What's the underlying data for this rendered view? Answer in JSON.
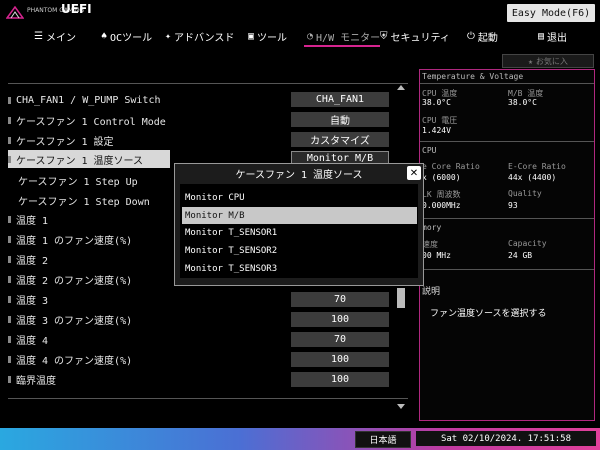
{
  "header": {
    "brand_small": "PHANTOM GAMING",
    "brand_uefi": "UEFI",
    "easy_mode_label": "Easy Mode(F6)",
    "tabs": [
      {
        "label": "メイン",
        "icon": "list-icon"
      },
      {
        "label": "OCツール",
        "icon": "flame-icon"
      },
      {
        "label": "アドバンスド",
        "icon": "star-icon"
      },
      {
        "label": "ツール",
        "icon": "toolbox-icon"
      },
      {
        "label": "H/W モニター",
        "icon": "gauge-icon"
      },
      {
        "label": "セキュリティ",
        "icon": "shield-icon"
      },
      {
        "label": "起動",
        "icon": "power-icon"
      },
      {
        "label": "退出",
        "icon": "exit-icon"
      }
    ],
    "favorites_label": "お気に入"
  },
  "settings": [
    {
      "label": "CHA_FAN1 / W_PUMP Switch",
      "value": "CHA_FAN1"
    },
    {
      "label": "ケースファン 1 Control Mode",
      "value": "自動"
    },
    {
      "label": "ケースファン 1 設定",
      "value": "カスタマイズ"
    },
    {
      "label": "ケースファン 1 温度ソース",
      "value": "Monitor M/B"
    },
    {
      "label": "ケースファン 1 Step Up",
      "value": ""
    },
    {
      "label": "ケースファン 1 Step Down",
      "value": ""
    },
    {
      "label": "温度 1",
      "value": ""
    },
    {
      "label": "温度 1 のファン速度(%)",
      "value": ""
    },
    {
      "label": "温度 2",
      "value": ""
    },
    {
      "label": "温度 2 のファン速度(%)",
      "value": ""
    },
    {
      "label": "温度 3",
      "value": "70"
    },
    {
      "label": "温度 3 のファン速度(%)",
      "value": "100"
    },
    {
      "label": "温度 4",
      "value": "70"
    },
    {
      "label": "温度 4 のファン速度(%)",
      "value": "100"
    },
    {
      "label": "臨界温度",
      "value": "100"
    }
  ],
  "modal": {
    "title": "ケースファン 1 温度ソース",
    "options": [
      "Monitor CPU",
      "Monitor M/B",
      "Monitor T_SENSOR1",
      "Monitor T_SENSOR2",
      "Monitor T_SENSOR3"
    ],
    "selected_index": 1
  },
  "right_panel": {
    "section1": "Temperature & Voltage",
    "cpu_temp_label": "CPU 温度",
    "cpu_temp_value": "38.0°C",
    "mb_temp_label": "M/B 温度",
    "mb_temp_value": "38.0°C",
    "cpu_volt_label": "CPU 電圧",
    "cpu_volt_value": "1.424V",
    "section2": "CPU",
    "pcore_label": "e Core Ratio",
    "pcore_value": "x (6000)",
    "ecore_label": "E-Core Ratio",
    "ecore_value": "44x (4400)",
    "bclk_label": "LK 周波数",
    "bclk_value": "0.000MHz",
    "quality_label": "Quality",
    "quality_value": "93",
    "section3": "mory",
    "speed_label": "速度",
    "speed_value": "00 MHz",
    "capacity_label": "Capacity",
    "capacity_value": "24 GB",
    "desc_title": "説明",
    "description": "ファン温度ソースを選択する"
  },
  "footer": {
    "language": "日本語",
    "datetime": "Sat 02/10/2024. 17:51:58"
  }
}
